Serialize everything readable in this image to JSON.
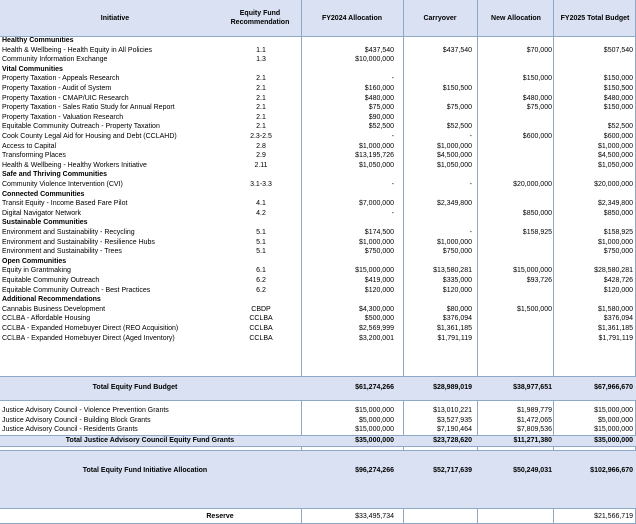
{
  "headers": {
    "initiative": "Initiative",
    "recommendation": "Equity Fund Recommendation",
    "fy2024": "FY2024 Allocation",
    "carryover": "Carryover",
    "new_allocation": "New Allocation",
    "fy2025": "FY2025 Total Budget"
  },
  "rows": [
    {
      "type": "section",
      "name": "Healthy Communities"
    },
    {
      "type": "item",
      "name": "Health & Wellbeing - Health Equity in All Policies",
      "rec": "1.1",
      "fy24": "$437,540",
      "carry": "$437,540",
      "newal": "$70,000",
      "total": "$507,540"
    },
    {
      "type": "item",
      "name": "Community Information Exchange",
      "rec": "1.3",
      "fy24": "$10,000,000",
      "carry": "",
      "newal": "",
      "total": ""
    },
    {
      "type": "section",
      "name": "Vital Communities"
    },
    {
      "type": "item",
      "name": "Property Taxation - Appeals Research",
      "rec": "2.1",
      "fy24": "-",
      "carry": "",
      "newal": "$150,000",
      "total": "$150,000"
    },
    {
      "type": "item",
      "name": "Property Taxation - Audit of System",
      "rec": "2.1",
      "fy24": "$160,000",
      "carry": "$150,500",
      "newal": "",
      "total": "$150,500"
    },
    {
      "type": "item",
      "name": "Property Taxation - CMAP/UIC Research",
      "rec": "2.1",
      "fy24": "$480,000",
      "carry": "",
      "newal": "$480,000",
      "total": "$480,000"
    },
    {
      "type": "item",
      "name": "Property Taxation - Sales Ratio Study for Annual Report",
      "rec": "2.1",
      "fy24": "$75,000",
      "carry": "$75,000",
      "newal": "$75,000",
      "total": "$150,000"
    },
    {
      "type": "item",
      "name": "Property Taxation - Valuation Research",
      "rec": "2.1",
      "fy24": "$90,000",
      "carry": "",
      "newal": "",
      "total": ""
    },
    {
      "type": "item",
      "name": "Equitable Community Outreach - Property Taxation",
      "rec": "2.1",
      "fy24": "$52,500",
      "carry": "$52,500",
      "newal": "",
      "total": "$52,500"
    },
    {
      "type": "item",
      "name": "Cook County Legal Aid for Housing and Debt (CCLAHD)",
      "rec": "2.3-2.5",
      "fy24": "-",
      "carry": "-",
      "newal": "$600,000",
      "total": "$600,000"
    },
    {
      "type": "item",
      "name": "Access to Capital",
      "rec": "2.8",
      "fy24": "$1,000,000",
      "carry": "$1,000,000",
      "newal": "",
      "total": "$1,000,000"
    },
    {
      "type": "item",
      "name": "Transforming Places",
      "rec": "2.9",
      "fy24": "$13,195,726",
      "carry": "$4,500,000",
      "newal": "",
      "total": "$4,500,000"
    },
    {
      "type": "item",
      "name": "Health & Wellbeing - Healthy Workers Initiative",
      "rec": "2.11",
      "fy24": "$1,050,000",
      "carry": "$1,050,000",
      "newal": "",
      "total": "$1,050,000"
    },
    {
      "type": "section",
      "name": "Safe and Thriving Communities"
    },
    {
      "type": "item",
      "name": "Community Violence Intervention (CVI)",
      "rec": "3.1-3.3",
      "fy24": "-",
      "carry": "-",
      "newal": "$20,000,000",
      "total": "$20,000,000"
    },
    {
      "type": "section",
      "name": "Connected Communities"
    },
    {
      "type": "item",
      "name": "Transit Equity - Income Based Fare Pilot",
      "rec": "4.1",
      "fy24": "$7,000,000",
      "carry": "$2,349,800",
      "newal": "",
      "total": "$2,349,800"
    },
    {
      "type": "item",
      "name": "Digital Navigator Network",
      "rec": "4.2",
      "fy24": "-",
      "carry": "",
      "newal": "$850,000",
      "total": "$850,000"
    },
    {
      "type": "section",
      "name": "Sustainable Communities"
    },
    {
      "type": "item",
      "name": "Environment and Sustainability - Recycling",
      "rec": "5.1",
      "fy24": "$174,500",
      "carry": "-",
      "newal": "$158,925",
      "total": "$158,925"
    },
    {
      "type": "item",
      "name": "Environment and Sustainability - Resilience Hubs",
      "rec": "5.1",
      "fy24": "$1,000,000",
      "carry": "$1,000,000",
      "newal": "",
      "total": "$1,000,000"
    },
    {
      "type": "item",
      "name": "Environment and Sustainability - Trees",
      "rec": "5.1",
      "fy24": "$750,000",
      "carry": "$750,000",
      "newal": "",
      "total": "$750,000"
    },
    {
      "type": "section",
      "name": "Open Communities"
    },
    {
      "type": "item",
      "name": "Equity in Grantmaking",
      "rec": "6.1",
      "fy24": "$15,000,000",
      "carry": "$13,580,281",
      "newal": "$15,000,000",
      "total": "$28,580,281"
    },
    {
      "type": "item",
      "name": "Equitable Community Outreach",
      "rec": "6.2",
      "fy24": "$419,000",
      "carry": "$335,000",
      "newal": "$93,726",
      "total": "$428,726"
    },
    {
      "type": "item",
      "name": "Equitable Community Outreach - Best Practices",
      "rec": "6.2",
      "fy24": "$120,000",
      "carry": "$120,000",
      "newal": "",
      "total": "$120,000"
    },
    {
      "type": "section",
      "name": "Additional Recommendations"
    },
    {
      "type": "item",
      "name": "Cannabis Business Development",
      "rec": "CBDP",
      "fy24": "$4,300,000",
      "carry": "$80,000",
      "newal": "$1,500,000",
      "total": "$1,580,000"
    },
    {
      "type": "item",
      "name": "CCLBA - Affordable Housing",
      "rec": "CCLBA",
      "fy24": "$500,000",
      "carry": "$376,094",
      "newal": "",
      "total": "$376,094"
    },
    {
      "type": "item",
      "name": "CCLBA - Expanded Homebuyer Direct (REO Acquisition)",
      "rec": "CCLBA",
      "fy24": "$2,569,999",
      "carry": "$1,361,185",
      "newal": "",
      "total": "$1,361,185"
    },
    {
      "type": "item",
      "name": "CCLBA - Expanded Homebuyer Direct (Aged Inventory)",
      "rec": "CCLBA",
      "fy24": "$3,200,001",
      "carry": "$1,791,119",
      "newal": "",
      "total": "$1,791,119"
    }
  ],
  "total_equity": {
    "label": "Total Equity Fund Budget",
    "fy24": "$61,274,266",
    "carry": "$28,989,019",
    "newal": "$38,977,651",
    "total": "$67,966,670"
  },
  "justice_rows": [
    {
      "name": "Justice Advisory Council - Violence Prevention Grants",
      "fy24": "$15,000,000",
      "carry": "$13,010,221",
      "newal": "$1,989,779",
      "total": "$15,000,000"
    },
    {
      "name": "Justice Advisory Council - Building Block Grants",
      "fy24": "$5,000,000",
      "carry": "$3,527,935",
      "newal": "$1,472,065",
      "total": "$5,000,000"
    },
    {
      "name": "Justice Advisory Council - Residents Grants",
      "fy24": "$15,000,000",
      "carry": "$7,190,464",
      "newal": "$7,809,536",
      "total": "$15,000,000"
    }
  ],
  "total_justice": {
    "label": "Total Justice Advisory Council Equity Fund Grants",
    "fy24": "$35,000,000",
    "carry": "$23,728,620",
    "newal": "$11,271,380",
    "total": "$35,000,000"
  },
  "total_initiative": {
    "label": "Total Equity Fund Initiative Allocation",
    "fy24": "$96,274,266",
    "carry": "$52,717,639",
    "newal": "$50,249,031",
    "total": "$102,966,670"
  },
  "reserve": {
    "label": "Reserve",
    "fy24": "$33,495,734",
    "total": "$21,566,719"
  }
}
